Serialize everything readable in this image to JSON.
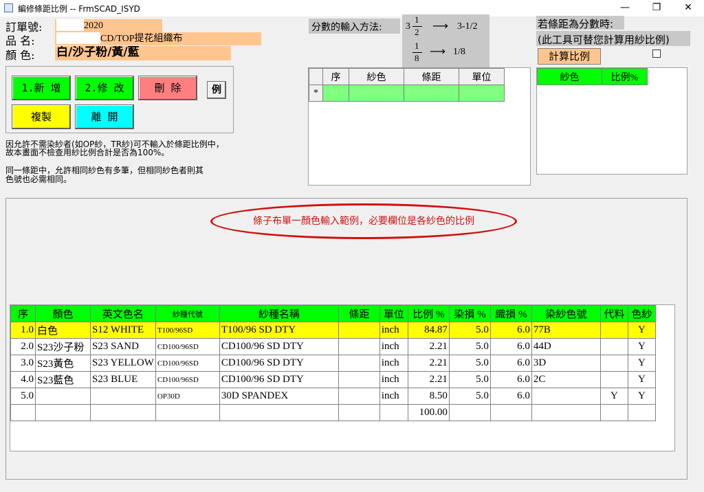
{
  "window": {
    "title": "編修條距比例 -- FrmSCAD_ISYD",
    "minimize": "—",
    "restore": "❐",
    "close": "✕"
  },
  "order": {
    "order_label": "訂單號:",
    "order_value": "2020",
    "product_label": "品  名:",
    "product_value": "CD/TOP提花組織布",
    "color_label": "顏  色:",
    "color_value": "白/沙子粉/黃/藍"
  },
  "buttons": {
    "add": "1.新  增",
    "edit": "2.修  改",
    "delete": "刪  除",
    "example": "例",
    "copy": "複製",
    "leave": "離  開"
  },
  "notes": {
    "line1": "因允許不需染紗者(如OP紗，TR紗)可不輸入於條距比例中，",
    "line2": "故本畫面不檢查用紗比例合計是否為100%。",
    "line3": "同一條距中，允許相同紗色有多筆，但相同紗色者則其",
    "line4": "色號也必需相同。"
  },
  "fraction_help": {
    "label": "分數的輸入方法:",
    "ex1_whole": "3",
    "ex1_num": "1",
    "ex1_den": "2",
    "ex1_arrow": "⟶",
    "ex1_result": "3-1/2",
    "ex2_num": "1",
    "ex2_den": "8",
    "ex2_arrow": "⟶",
    "ex2_result": "1/8"
  },
  "upper_grid": {
    "headers": [
      "序",
      "紗色",
      "條距",
      "單位"
    ],
    "new_row_marker": "*"
  },
  "ratio_tool": {
    "title": "若條距為分數時:",
    "subtitle": "(此工具可替您計算用紗比例)",
    "calc_button": "計算比例",
    "headers": [
      "紗色",
      "比例%"
    ]
  },
  "annotation": {
    "text": "條子布單一顏色輸入範例，必要欄位是各紗色的比例"
  },
  "main_grid": {
    "headers": [
      "序",
      "顏色",
      "英文色名",
      "紗種代號",
      "紗種名稱",
      "條距",
      "單位",
      "比例 %",
      "染損 %",
      "織損 %",
      "染紗色號",
      "代料",
      "色紗"
    ],
    "rows": [
      [
        "1.0",
        "白色",
        "S12 WHITE",
        "T100/96SD",
        "T100/96 SD DTY",
        "",
        "inch",
        "84.87",
        "5.0",
        "6.0",
        "77B",
        "",
        "Y"
      ],
      [
        "2.0",
        "S23沙子粉",
        "S23 SAND",
        "CD100/96SD",
        "CD100/96 SD DTY",
        "",
        "inch",
        "2.21",
        "5.0",
        "6.0",
        "44D",
        "",
        "Y"
      ],
      [
        "3.0",
        "S23黃色",
        "S23 YELLOW",
        "CD100/96SD",
        "CD100/96 SD DTY",
        "",
        "inch",
        "2.21",
        "5.0",
        "6.0",
        "3D",
        "",
        "Y"
      ],
      [
        "4.0",
        "S23藍色",
        "S23 BLUE",
        "CD100/96SD",
        "CD100/96 SD DTY",
        "",
        "inch",
        "2.21",
        "5.0",
        "6.0",
        "2C",
        "",
        "Y"
      ],
      [
        "5.0",
        "",
        "",
        "OP30D",
        "30D SPANDEX",
        "",
        "inch",
        "8.50",
        "5.0",
        "6.0",
        "",
        "Y",
        "Y"
      ],
      [
        "",
        "",
        "",
        "",
        "",
        "",
        "",
        "100.00",
        "",
        "",
        "",
        "",
        ""
      ]
    ]
  },
  "colors": {
    "header_green": "#00ff00",
    "new_row_green": "#80ff80",
    "highlight_yellow": "#ffff00",
    "btn_green": "#00ff00",
    "btn_red": "#ff7f7f",
    "btn_yellow": "#ffff00",
    "btn_cyan": "#00ffff",
    "field_orange": "#ffc58f",
    "annotation_red": "#d01010"
  }
}
